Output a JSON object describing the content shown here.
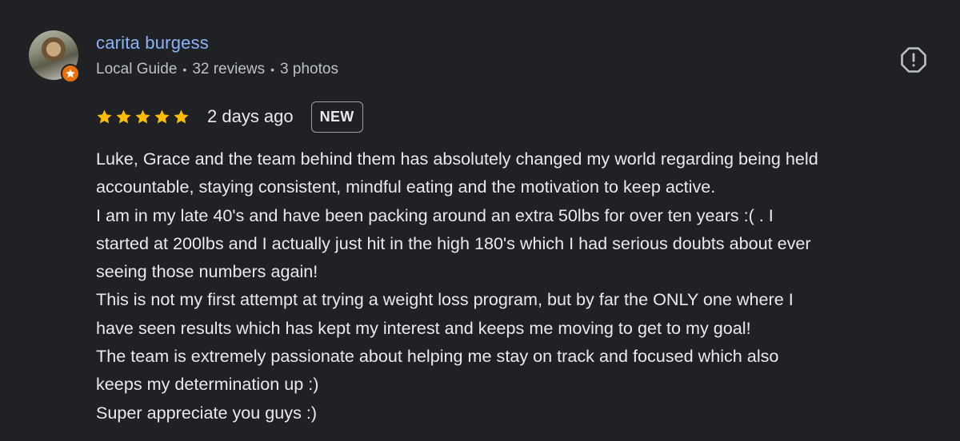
{
  "reviewer": {
    "name": "carita burgess",
    "role": "Local Guide",
    "reviews": "32 reviews",
    "photos": "3 photos",
    "separator": "•",
    "avatar_icon": "person-photo",
    "badge_icon": "star-icon"
  },
  "actions": {
    "report_icon": "report-flag-icon"
  },
  "rating": {
    "stars": 5,
    "max_stars": 5,
    "star_color": "#fbbc04",
    "date": "2 days ago",
    "badge": "NEW"
  },
  "review_lines": [
    "Luke, Grace and the team behind them has absolutely changed my world regarding being held",
    "accountable, staying consistent, mindful eating and the motivation to keep active.",
    "I am in my late 40's and have been packing around an extra 50lbs for over ten years :( . I",
    "started at 200lbs and I actually just hit in the high 180's which I had serious doubts about ever",
    "seeing those numbers again!",
    "This is not my first attempt at trying a weight loss program, but by far the ONLY one where I",
    "have seen results which has kept my interest and keeps me moving to get to my goal!",
    "The team is extremely passionate about helping me stay on track and focused which also",
    "keeps my determination up :)",
    "Super appreciate you guys :)"
  ],
  "colors": {
    "background": "#202124",
    "name": "#8ab4f8",
    "text": "#e8eaed",
    "meta": "#bdc1c6",
    "guide_badge": "#e8710a"
  }
}
